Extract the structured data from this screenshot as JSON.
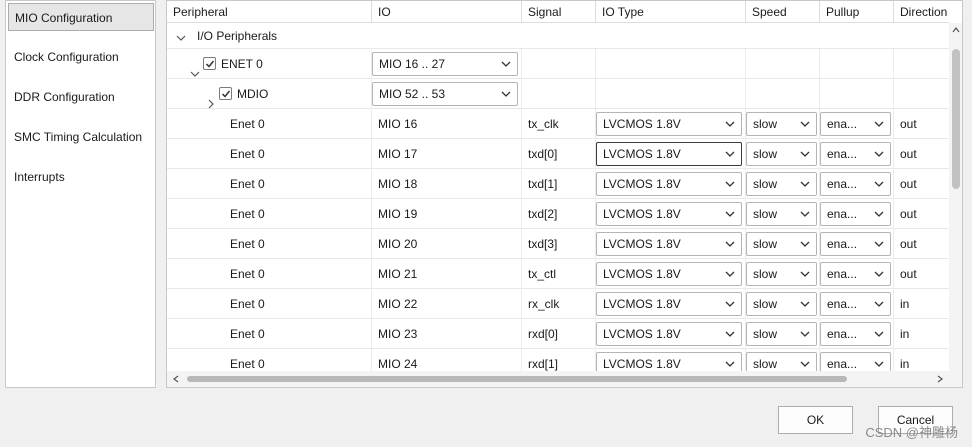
{
  "nav": {
    "items": [
      {
        "label": "MIO Configuration",
        "selected": true
      },
      {
        "label": "Clock Configuration",
        "selected": false
      },
      {
        "label": "DDR Configuration",
        "selected": false
      },
      {
        "label": "SMC Timing Calculation",
        "selected": false
      },
      {
        "label": "Interrupts",
        "selected": false
      }
    ]
  },
  "grid": {
    "columns": [
      "Peripheral",
      "IO",
      "Signal",
      "IO Type",
      "Speed",
      "Pullup",
      "Direction"
    ],
    "group_label": "I/O Peripherals",
    "enet": {
      "label": "ENET 0",
      "io": "MIO 16 .. 27",
      "checked": true
    },
    "mdio": {
      "label": "MDIO",
      "io": "MIO 52 .. 53",
      "checked": true
    },
    "rows": [
      {
        "peripheral": "Enet 0",
        "io": "MIO 16",
        "signal": "tx_clk",
        "io_type": "LVCMOS 1.8V",
        "speed": "slow",
        "pullup": "ena...",
        "direction": "out"
      },
      {
        "peripheral": "Enet 0",
        "io": "MIO 17",
        "signal": "txd[0]",
        "io_type": "LVCMOS 1.8V",
        "speed": "slow",
        "pullup": "ena...",
        "direction": "out"
      },
      {
        "peripheral": "Enet 0",
        "io": "MIO 18",
        "signal": "txd[1]",
        "io_type": "LVCMOS 1.8V",
        "speed": "slow",
        "pullup": "ena...",
        "direction": "out"
      },
      {
        "peripheral": "Enet 0",
        "io": "MIO 19",
        "signal": "txd[2]",
        "io_type": "LVCMOS 1.8V",
        "speed": "slow",
        "pullup": "ena...",
        "direction": "out"
      },
      {
        "peripheral": "Enet 0",
        "io": "MIO 20",
        "signal": "txd[3]",
        "io_type": "LVCMOS 1.8V",
        "speed": "slow",
        "pullup": "ena...",
        "direction": "out"
      },
      {
        "peripheral": "Enet 0",
        "io": "MIO 21",
        "signal": "tx_ctl",
        "io_type": "LVCMOS 1.8V",
        "speed": "slow",
        "pullup": "ena...",
        "direction": "out"
      },
      {
        "peripheral": "Enet 0",
        "io": "MIO 22",
        "signal": "rx_clk",
        "io_type": "LVCMOS 1.8V",
        "speed": "slow",
        "pullup": "ena...",
        "direction": "in"
      },
      {
        "peripheral": "Enet 0",
        "io": "MIO 23",
        "signal": "rxd[0]",
        "io_type": "LVCMOS 1.8V",
        "speed": "slow",
        "pullup": "ena...",
        "direction": "in"
      },
      {
        "peripheral": "Enet 0",
        "io": "MIO 24",
        "signal": "rxd[1]",
        "io_type": "LVCMOS 1.8V",
        "speed": "slow",
        "pullup": "ena...",
        "direction": "in"
      }
    ]
  },
  "buttons": {
    "ok": "OK",
    "cancel": "Cancel"
  },
  "watermark": "CSDN @神雕杨",
  "icons": {
    "expand": "chevron-down-icon",
    "collapse": "chevron-right-icon",
    "dropdown": "chevron-down-icon",
    "checkbox": "check-icon"
  }
}
